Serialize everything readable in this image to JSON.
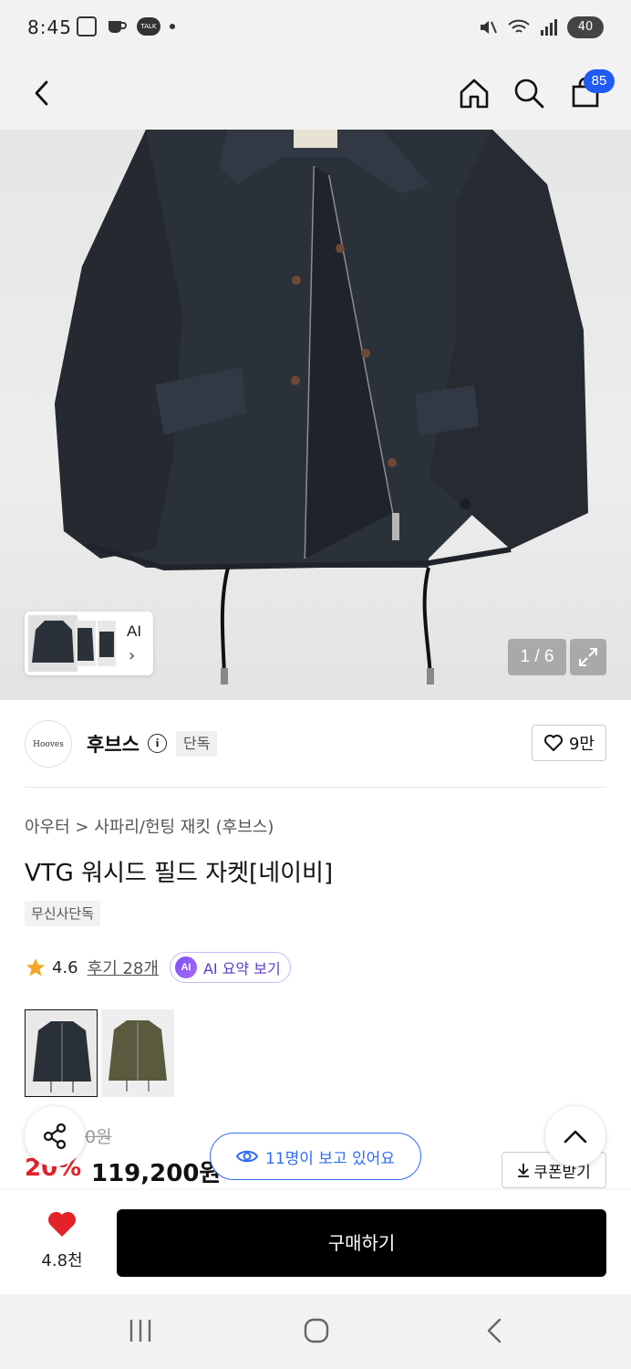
{
  "status_bar": {
    "time": "8:45",
    "talk_label": "TALK",
    "battery": "40"
  },
  "header": {
    "cart_count": "85"
  },
  "gallery": {
    "thumb_ai_label": "AI",
    "thumb_chevron": "›",
    "counter": "1 / 6"
  },
  "brand": {
    "logo_text": "Hooves",
    "name": "후브스",
    "info_glyph": "i",
    "tag": "단독",
    "like_count": "9만"
  },
  "product": {
    "breadcrumb": "아우터 > 사파리/헌팅 재킷 (후브스)",
    "title": "VTG 워시드 필드 자켓[네이비]",
    "exclusive_tag": "무신사단독",
    "rating": "4.6",
    "review_link": "후기 28개",
    "ai_badge": "AI",
    "ai_summary": "AI 요약 보기"
  },
  "price": {
    "original": "0원",
    "discount": "20%",
    "sale": "119,200원",
    "coupon": "쿠폰받기"
  },
  "floating": {
    "viewers": "11명이 보고 있어요"
  },
  "bottom_bar": {
    "wish_count": "4.8천",
    "buy_label": "구매하기"
  },
  "colors": {
    "accent_blue": "#2f6cf3",
    "badge_blue": "#1f5bf2",
    "discount_red": "#e3222a",
    "heart_red": "#e3222a",
    "ai_purple": "#5b3bc9",
    "jacket_navy": "#2a3038",
    "jacket_olive": "#5a5b3e"
  }
}
